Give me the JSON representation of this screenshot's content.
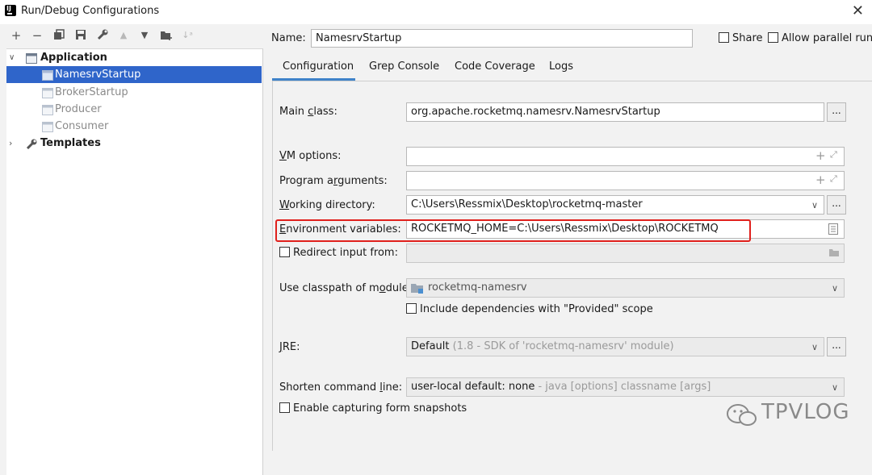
{
  "window": {
    "title": "Run/Debug Configurations",
    "close_glyph": "✕"
  },
  "toolbar": {
    "icons": [
      "add-icon",
      "remove-icon",
      "copy-icon",
      "save-icon",
      "wrench-icon",
      "move-up-icon",
      "move-down-icon",
      "new-folder-icon",
      "sort-icon"
    ]
  },
  "tree": {
    "application": {
      "label": "Application"
    },
    "items": [
      {
        "label": "NamesrvStartup",
        "selected": true
      },
      {
        "label": "BrokerStartup"
      },
      {
        "label": "Producer"
      },
      {
        "label": "Consumer"
      }
    ],
    "templates": {
      "label": "Templates"
    }
  },
  "header": {
    "name_label": "Name:",
    "name_value": "NamesrvStartup",
    "share_label": "Share",
    "parallel_label": "Allow parallel run"
  },
  "tabs": [
    "Configuration",
    "Grep Console",
    "Code Coverage",
    "Logs"
  ],
  "form": {
    "main_class_label": "Main class:",
    "main_class_value": "org.apache.rocketmq.namesrv.NamesrvStartup",
    "vm_options_label": "VM options:",
    "program_args_label": "Program arguments:",
    "working_dir_label": "Working directory:",
    "working_dir_value": "C:\\Users\\Ressmix\\Desktop\\rocketmq-master",
    "env_label": "Environment variables:",
    "env_value": "ROCKETMQ_HOME=C:\\Users\\Ressmix\\Desktop\\ROCKETMQ",
    "redirect_label": "Redirect input from:",
    "classpath_label": "Use classpath of module:",
    "classpath_value": "rocketmq-namesrv",
    "include_deps_label": "Include dependencies with \"Provided\" scope",
    "jre_label": "JRE:",
    "jre_default": "Default",
    "jre_detail": "(1.8 - SDK of 'rocketmq-namesrv' module)",
    "shorten_label": "Shorten command line:",
    "shorten_value": "user-local default: none",
    "shorten_detail": "- java [options] classname [args]",
    "snapshots_label": "Enable capturing form snapshots",
    "dots": "...",
    "highlight_color": "#e0201c"
  },
  "watermark": {
    "text": "TPVLOG"
  }
}
